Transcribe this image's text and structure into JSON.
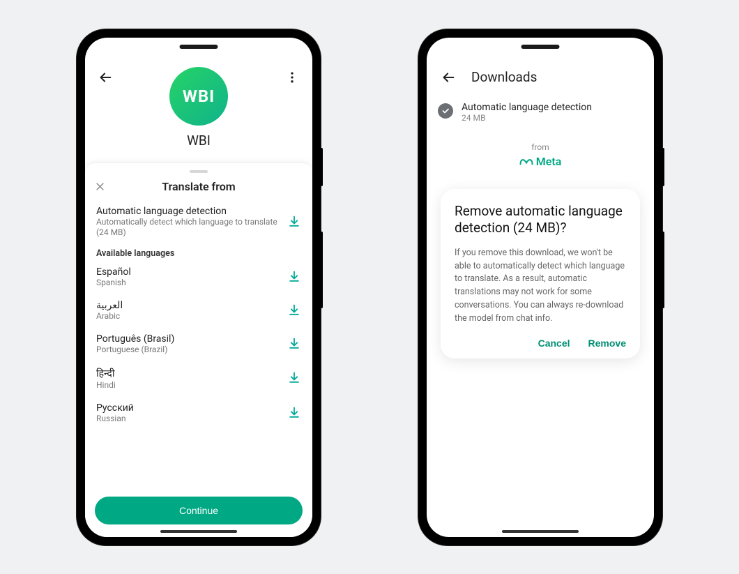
{
  "left": {
    "profile": {
      "avatar_text": "WBI",
      "name": "WBI"
    },
    "sheet": {
      "title": "Translate from",
      "auto": {
        "title": "Automatic language detection",
        "subtitle": "Automatically detect which language to translate (24 MB)"
      },
      "section_label": "Available languages",
      "languages": [
        {
          "native": "Español",
          "english": "Spanish"
        },
        {
          "native": "العربية",
          "english": "Arabic"
        },
        {
          "native": "Português (Brasil)",
          "english": "Portuguese (Brazil)"
        },
        {
          "native": "हिन्दी",
          "english": "Hindi"
        },
        {
          "native": "Русский",
          "english": "Russian"
        }
      ],
      "continue_label": "Continue"
    }
  },
  "right": {
    "title": "Downloads",
    "item": {
      "title": "Automatic language detection",
      "size": "24 MB"
    },
    "from_label": "from",
    "brand": "Meta",
    "dialog": {
      "title": "Remove automatic language detection (24 MB)?",
      "body": "If you remove this download, we won't be able to automatically detect which language to translate. As a result, automatic translations may not work for some conversations. You can always re-download the model from chat info.",
      "cancel": "Cancel",
      "remove": "Remove"
    }
  }
}
